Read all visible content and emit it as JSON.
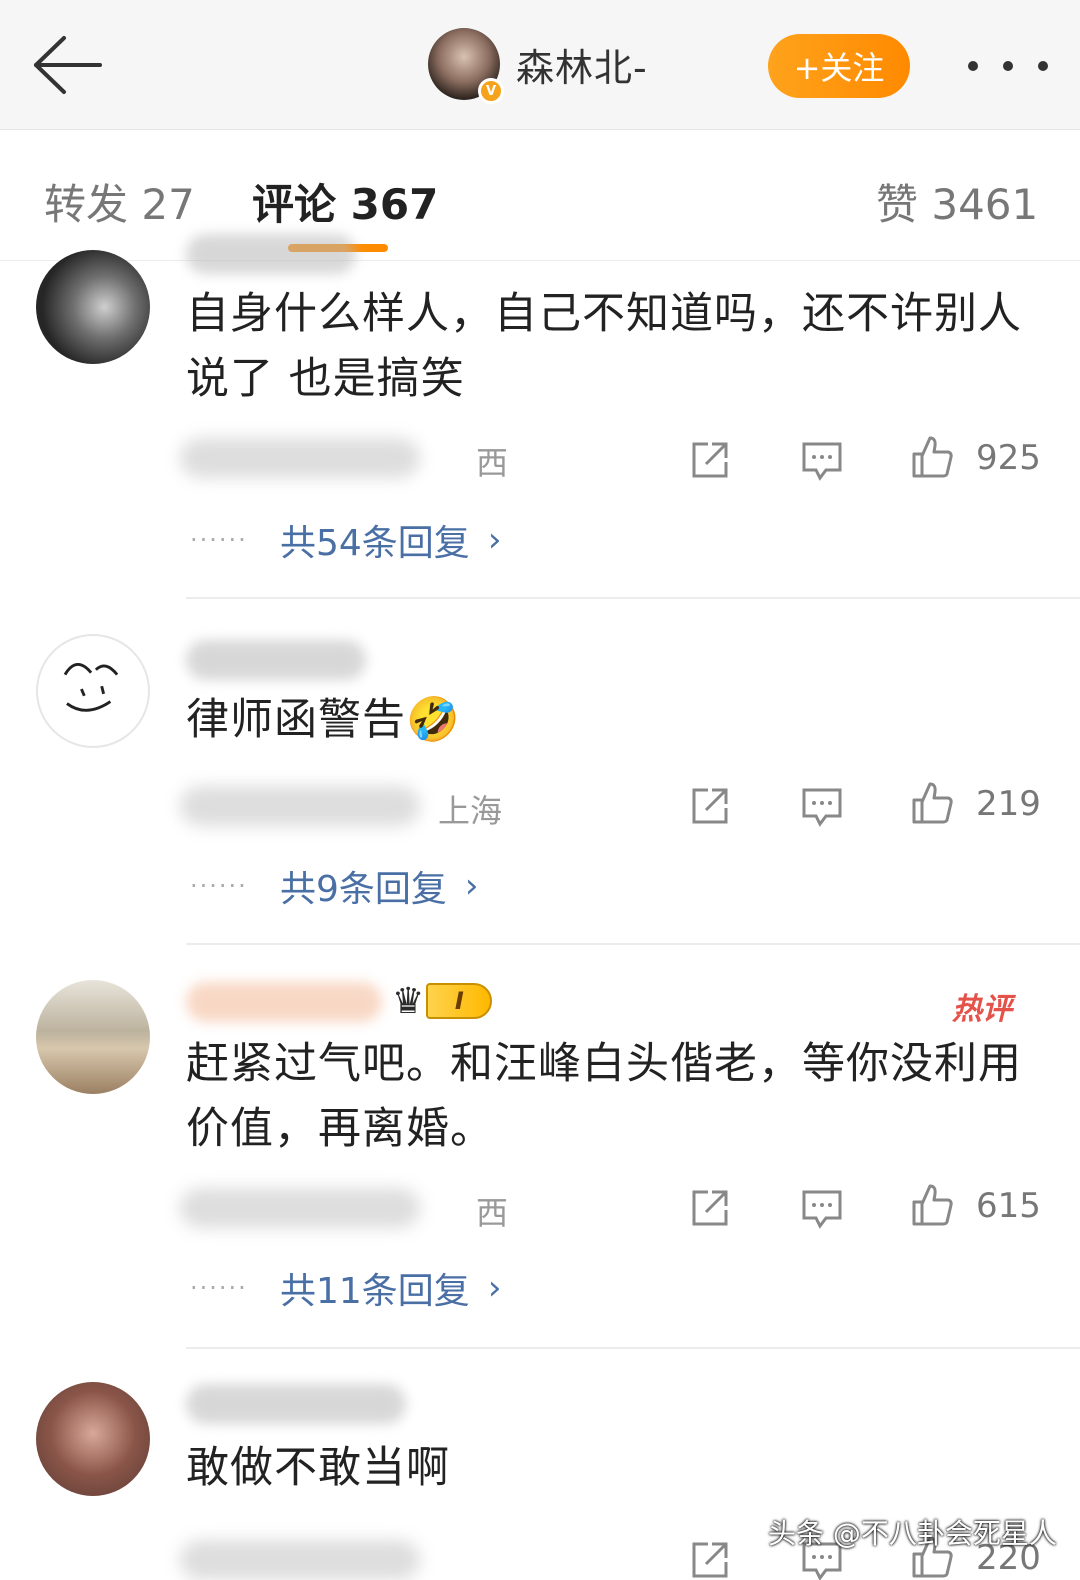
{
  "header": {
    "username": "森林北-",
    "follow_label": "+关注",
    "verified_badge": "V"
  },
  "tabs": {
    "repost": "转发 27",
    "comments": "评论 367",
    "likes": "赞 3461"
  },
  "comments": [
    {
      "text": "自身什么样人，自己不知道吗，还不许别人说了 也是搞笑",
      "location": "西",
      "like_count": "925",
      "replies_label": "共54条回复"
    },
    {
      "text": "律师函警告",
      "emoji": "🤣",
      "location": "上海",
      "like_count": "219",
      "replies_label": "共9条回复"
    },
    {
      "text": "赶紧过气吧。和汪峰白头偕老，等你没利用价值，再离婚。",
      "hot_label": "热评",
      "level_label": "I",
      "location": "西",
      "like_count": "615",
      "replies_label": "共11条回复"
    },
    {
      "text": "敢做不敢当啊",
      "like_count": "220"
    }
  ],
  "icons": {
    "back": "arrow-left-icon",
    "more": "more-dots-icon",
    "share": "share-icon",
    "reply": "comment-icon",
    "like": "thumbs-up-icon"
  },
  "colors": {
    "accent": "#ff8c00",
    "link": "#4a6fa5",
    "hot": "#e5524a"
  },
  "watermark": "头条 @不八卦会死星人"
}
